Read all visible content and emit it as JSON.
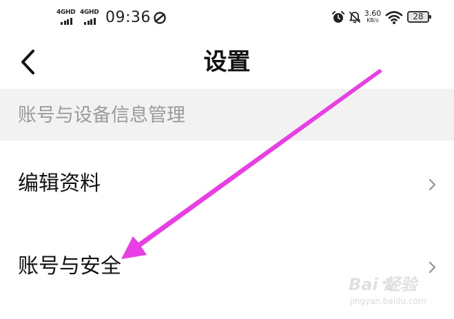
{
  "status_bar": {
    "sim1_label": "4GHD",
    "sim2_label": "4GHD",
    "time": "09:36",
    "net_speed_value": "3.60",
    "net_speed_unit": "KB/s",
    "battery": "28",
    "icons": [
      "signal-icon",
      "sync-icon",
      "alarm-icon",
      "bell-off-icon",
      "wifi-icon",
      "battery-icon"
    ]
  },
  "header": {
    "title": "设置",
    "back_icon": "chevron-left-icon"
  },
  "section": {
    "title": "账号与设备信息管理"
  },
  "list": {
    "items": [
      {
        "label": "编辑资料",
        "icon": "chevron-right-icon"
      },
      {
        "label": "账号与安全",
        "icon": "chevron-right-icon"
      }
    ]
  },
  "annotation": {
    "color": "#e83ee3"
  },
  "watermark": {
    "brand_top": "Bai  经验",
    "brand_bottom": "jingyan.baidu.com"
  }
}
